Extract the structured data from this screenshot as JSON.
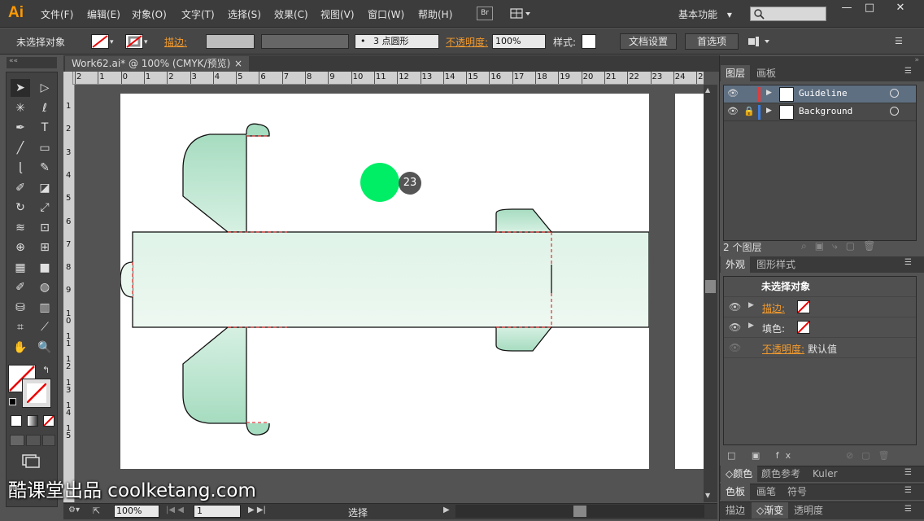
{
  "app": {
    "logo": "Ai"
  },
  "menu": [
    "文件(F)",
    "编辑(E)",
    "对象(O)",
    "文字(T)",
    "选择(S)",
    "效果(C)",
    "视图(V)",
    "窗口(W)",
    "帮助(H)"
  ],
  "menubar": {
    "bridge": "Br",
    "workspace": "基本功能",
    "workspace_arrow": "▾"
  },
  "window_controls": {
    "minimize": "—",
    "maximize": "□",
    "close": "✕"
  },
  "control_bar": {
    "selection_status": "未选择对象",
    "stroke_label": "描边:",
    "brush_label": "3 点圆形",
    "opacity_label": "不透明度:",
    "opacity_value": "100%",
    "style_label": "样式:",
    "doc_setup_button": "文档设置",
    "preferences_button": "首选项"
  },
  "document_tab": {
    "title": "Work62.ai* @ 100% (CMYK/预览)",
    "close": "×"
  },
  "rulers": {
    "horizontal": [
      "2",
      "1",
      "0",
      "1",
      "2",
      "3",
      "4",
      "5",
      "6",
      "7",
      "8",
      "9",
      "10",
      "11",
      "12",
      "13",
      "14",
      "15",
      "16",
      "17",
      "18",
      "19",
      "20",
      "21",
      "22",
      "23",
      "24",
      "25"
    ],
    "vertical": [
      "1",
      "2",
      "3",
      "4",
      "5",
      "6",
      "7",
      "8",
      "9",
      "1\n0",
      "1\n1",
      "1\n2",
      "1\n3",
      "1\n4",
      "1\n5"
    ]
  },
  "cursor_badge": {
    "number": "23",
    "color": "#00ee66"
  },
  "status_bar": {
    "zoom": "100%",
    "page": "1",
    "tool": "选择"
  },
  "layers_panel": {
    "tabs": [
      "图层",
      "画板"
    ],
    "layers": [
      {
        "name": "Guideline",
        "color": "#e03c3c",
        "locked": false
      },
      {
        "name": "Background",
        "color": "#3c7ee0",
        "locked": true
      }
    ],
    "count": "2 个图层"
  },
  "appearance_panel": {
    "tabs": [
      "外观",
      "图形样式"
    ],
    "title": "未选择对象",
    "stroke_label": "描边:",
    "fill_label": "填色:",
    "opacity_label": "不透明度:",
    "opacity_value": "默认值"
  },
  "bottom_panels": {
    "row1": [
      "颜色",
      "颜色参考",
      "Kuler"
    ],
    "row2": [
      "色板",
      "画笔",
      "符号"
    ],
    "row3": [
      "描边",
      "渐变",
      "透明度"
    ]
  },
  "watermark": "酷课堂出品 coolketang.com",
  "colors": {
    "accent_orange": "#f29a2e",
    "panel_bg": "#535353",
    "shape_fill": "#a6dcc0"
  }
}
